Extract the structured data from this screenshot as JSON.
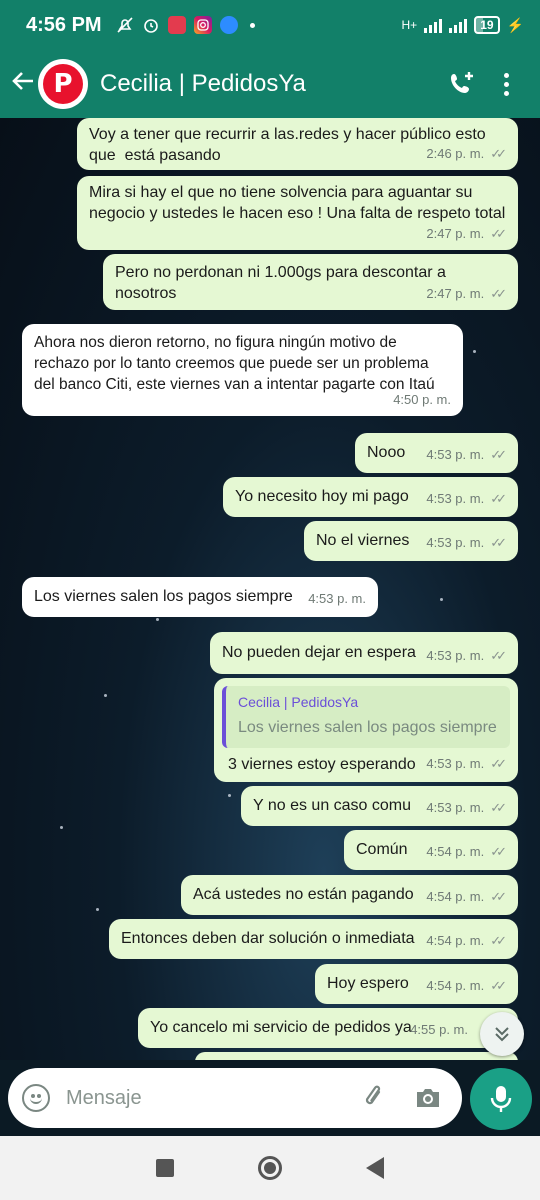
{
  "status_bar": {
    "time": "4:56 PM",
    "network": "H+",
    "battery": "19",
    "icons": [
      "silent-mode-icon",
      "alarm-icon",
      "app-icon",
      "instagram-icon",
      "camera-app-icon",
      "dot-icon"
    ]
  },
  "header": {
    "contact_name": "Cecilia | PedidosYa",
    "avatar_letter": "P",
    "accent_color": "#128069"
  },
  "messages": [
    {
      "direction": "out",
      "text": "Voy a tener que recurrir a las.redes y hacer público esto\nque  está pasando",
      "time": "2:46 p. m."
    },
    {
      "direction": "out",
      "text": "Mira si hay el que no tiene solvencia para aguantar su\nnegocio y ustedes le hacen eso ! Una falta de respeto total",
      "time": "2:47 p. m."
    },
    {
      "direction": "out",
      "text": "Pero no perdonan ni 1.000gs para descontar a nosotros",
      "time": "2:47 p. m."
    },
    {
      "direction": "in",
      "text": "Ahora nos dieron retorno, no figura ningún motivo de\nrechazo por lo tanto creemos que puede ser un problema\ndel banco Citi, este viernes van a intentar pagarte con Itaú",
      "time": "4:50 p. m."
    },
    {
      "direction": "out",
      "text": "Nooo",
      "time": "4:53 p. m."
    },
    {
      "direction": "out",
      "text": "Yo necesito hoy mi pago",
      "time": "4:53 p. m."
    },
    {
      "direction": "out",
      "text": "No el viernes",
      "time": "4:53 p. m."
    },
    {
      "direction": "in",
      "text": "Los viernes salen los pagos siempre",
      "time": "4:53 p. m."
    },
    {
      "direction": "out",
      "text": "No pueden dejar en espera",
      "time": "4:53 p. m."
    },
    {
      "direction": "out",
      "text": "3 viernes estoy esperando",
      "time": "4:53 p. m.",
      "quote": {
        "author": "Cecilia | PedidosYa",
        "text": "Los viernes salen los pagos siempre"
      }
    },
    {
      "direction": "out",
      "text": "Y no es un caso comu",
      "time": "4:53 p. m."
    },
    {
      "direction": "out",
      "text": "Común",
      "time": "4:54 p. m."
    },
    {
      "direction": "out",
      "text": "Acá ustedes no están pagando",
      "time": "4:54 p. m."
    },
    {
      "direction": "out",
      "text": "Entonces deben dar solución o inmediata",
      "time": "4:54 p. m."
    },
    {
      "direction": "out",
      "text": "Hoy espero",
      "time": "4:54 p. m."
    },
    {
      "direction": "out",
      "text": "Yo cancelo mi servicio de pedidos ya",
      "time": "4:55 p. m."
    }
  ],
  "composer": {
    "placeholder": "Mensaje"
  }
}
